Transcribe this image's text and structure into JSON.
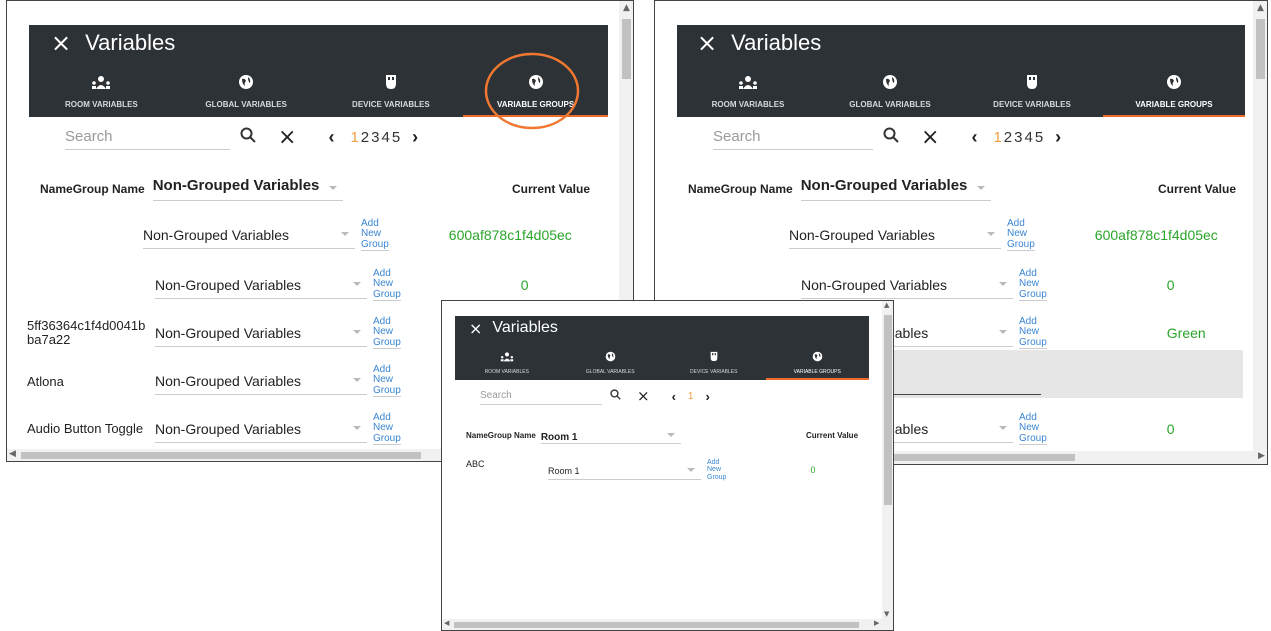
{
  "window_title": "Variables",
  "close_glyph": "×",
  "tabs": [
    {
      "label": "ROOM VARIABLES",
      "icon": "people-room-icon"
    },
    {
      "label": "GLOBAL VARIABLES",
      "icon": "globe-icon"
    },
    {
      "label": "DEVICE VARIABLES",
      "icon": "device-icon"
    },
    {
      "label": "VARIABLE GROUPS",
      "icon": "globe-icon",
      "active": true
    }
  ],
  "search": {
    "placeholder": "Search"
  },
  "pager": {
    "prev": "‹",
    "next": "›",
    "pages": [
      "1",
      "2",
      "3",
      "4",
      "5"
    ],
    "current": "1"
  },
  "table": {
    "name_header": "Name",
    "group_header": "Group Name",
    "group_filter": "Non-Grouped Variables",
    "value_header": "Current Value",
    "add_group": [
      "Add",
      "New",
      "Group"
    ]
  },
  "panel_left": {
    "rows": [
      {
        "name": "",
        "group": "Non-Grouped Variables",
        "value": "600af878c1f4d05ec"
      },
      {
        "name": "",
        "group": "Non-Grouped Variables",
        "value": "0"
      },
      {
        "name": "5ff36364c1f4d0041bba7a22",
        "group": "Non-Grouped Variables",
        "value": ""
      },
      {
        "name": "Atlona",
        "group": "Non-Grouped Variables",
        "value": ""
      },
      {
        "name": "Audio Button Toggle",
        "group": "Non-Grouped Variables",
        "value": ""
      }
    ]
  },
  "panel_right": {
    "rows": [
      {
        "name": "",
        "group": "Non-Grouped Variables",
        "value": "600af878c1f4d05ec"
      },
      {
        "name": "",
        "group": "Non-Grouped Variables",
        "value": "0"
      },
      {
        "name": "",
        "group": "riables",
        "value": "Green"
      },
      {
        "name": "",
        "group": "riables",
        "value": "0"
      }
    ]
  },
  "panel_front": {
    "group_filter": "Room 1",
    "pages": [
      "1"
    ],
    "rows": [
      {
        "name": "ABC",
        "group": "Room 1",
        "value": "0"
      }
    ]
  },
  "colors": {
    "header": "#2d3237",
    "accent": "#ef6b2b",
    "link": "#3a86d4",
    "value": "#2aa52a",
    "page_current": "#f0a040",
    "highlight_circle": "#f07830"
  }
}
